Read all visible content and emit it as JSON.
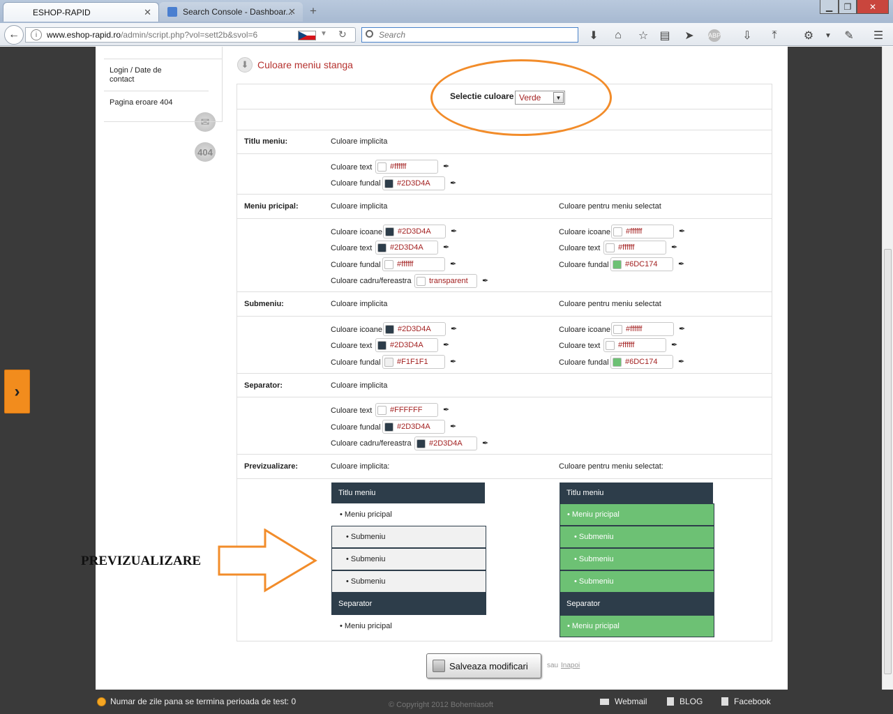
{
  "browser": {
    "tabs": [
      {
        "label": "ESHOP-RAPID",
        "close": "✕"
      },
      {
        "label": "Search Console - Dashboar...",
        "close": "✕"
      }
    ],
    "new_tab": "+",
    "url_host": "www.eshop-rapid.ro",
    "url_path": "/admin/script.php?vol=sett2b&svol=6",
    "search_placeholder": "Search"
  },
  "sidebar": {
    "items": [
      {
        "label": "Login / Date de contact"
      },
      {
        "label": "Pagina eroare 404",
        "icon_text": "404"
      }
    ]
  },
  "section": {
    "title": "Culoare meniu stanga",
    "selector_label": "Selectie culoare",
    "selector_value": "Verde"
  },
  "labels": {
    "default_color": "Culoare implicita",
    "selected_color": "Culoare pentru meniu selectat",
    "default_color_colon": "Culoare implicita:",
    "selected_color_colon": "Culoare pentru meniu selectat:",
    "text": "Culoare text",
    "background": "Culoare fundal",
    "icons": "Culoare icoane",
    "frame": "Culoare cadru/fereastra"
  },
  "groups": {
    "title": {
      "name": "Titlu meniu:",
      "text": "#ffffff",
      "background": "#2D3D4A"
    },
    "main": {
      "name": "Meniu pricipal:",
      "icons": "#2D3D4A",
      "text": "#2D3D4A",
      "background": "#ffffff",
      "frame": "transparent",
      "sel_icons": "#ffffff",
      "sel_text": "#ffffff",
      "sel_background": "#6DC174"
    },
    "sub": {
      "name": "Submeniu:",
      "icons": "#2D3D4A",
      "text": "#2D3D4A",
      "background": "#F1F1F1",
      "sel_icons": "#ffffff",
      "sel_text": "#ffffff",
      "sel_background": "#6DC174"
    },
    "separator": {
      "name": "Separator:",
      "text": "#FFFFFF",
      "background": "#2D3D4A",
      "frame": "#2D3D4A"
    }
  },
  "preview": {
    "name": "Previzualizare:",
    "title": "Titlu meniu",
    "main_item": "• Meniu pricipal",
    "sub_item": "• Submeniu",
    "separator": "Separator",
    "annotation": "PREVIZUALIZARE"
  },
  "actions": {
    "save": "Salveaza modificari",
    "or": "sau",
    "back": "Inapoi"
  },
  "footer": {
    "trial": "Numar de zile pana se termina perioada de test: 0",
    "copyright": "© Copyright 2012 Bohemiasoft",
    "links": [
      "Webmail",
      "BLOG",
      "Facebook"
    ]
  },
  "colors": {
    "accent_orange": "#f28c2a",
    "dark": "#2D3D4A",
    "green": "#6DC174",
    "title_red": "#b5312e"
  }
}
